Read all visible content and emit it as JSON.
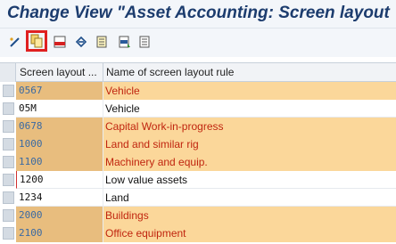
{
  "window": {
    "title": "Change View \"Asset Accounting: Screen layout"
  },
  "toolbar": {
    "buttons": [
      {
        "icon": "edit-pencil-icon",
        "highlighted": false
      },
      {
        "icon": "copy-as-icon",
        "highlighted": true
      },
      {
        "icon": "delete-icon",
        "highlighted": false
      },
      {
        "icon": "undo-change-icon",
        "highlighted": false
      },
      {
        "icon": "select-all-icon",
        "highlighted": false
      },
      {
        "icon": "select-block-icon",
        "highlighted": false
      },
      {
        "icon": "deselect-all-icon",
        "highlighted": false
      }
    ]
  },
  "table": {
    "columns": [
      "Screen layout ...",
      "Name of screen layout rule"
    ],
    "rows": [
      {
        "code": "0567",
        "name": "Vehicle",
        "editable": false
      },
      {
        "code": "05M",
        "name": "Vehicle",
        "editable": true
      },
      {
        "code": "0678",
        "name": "Capital Work-in-progress",
        "editable": false
      },
      {
        "code": "1000",
        "name": "Land and similar rig",
        "editable": false
      },
      {
        "code": "1100",
        "name": "Machinery and equip.",
        "editable": false
      },
      {
        "code": "1200",
        "name": "Low value assets",
        "editable": true
      },
      {
        "code": "1234",
        "name": "Land",
        "editable": true
      },
      {
        "code": "2000",
        "name": "Buildings",
        "editable": false
      },
      {
        "code": "2100",
        "name": "Office equipment",
        "editable": false
      }
    ]
  },
  "colors": {
    "readonly_key_bg": "#e8bd7e",
    "readonly_text_bg": "#fbd79a",
    "readonly_key_text": "#3a6aa3",
    "readonly_name_text": "#c0250f",
    "title_text": "#1c3c6e",
    "highlight_border": "#e02020"
  }
}
